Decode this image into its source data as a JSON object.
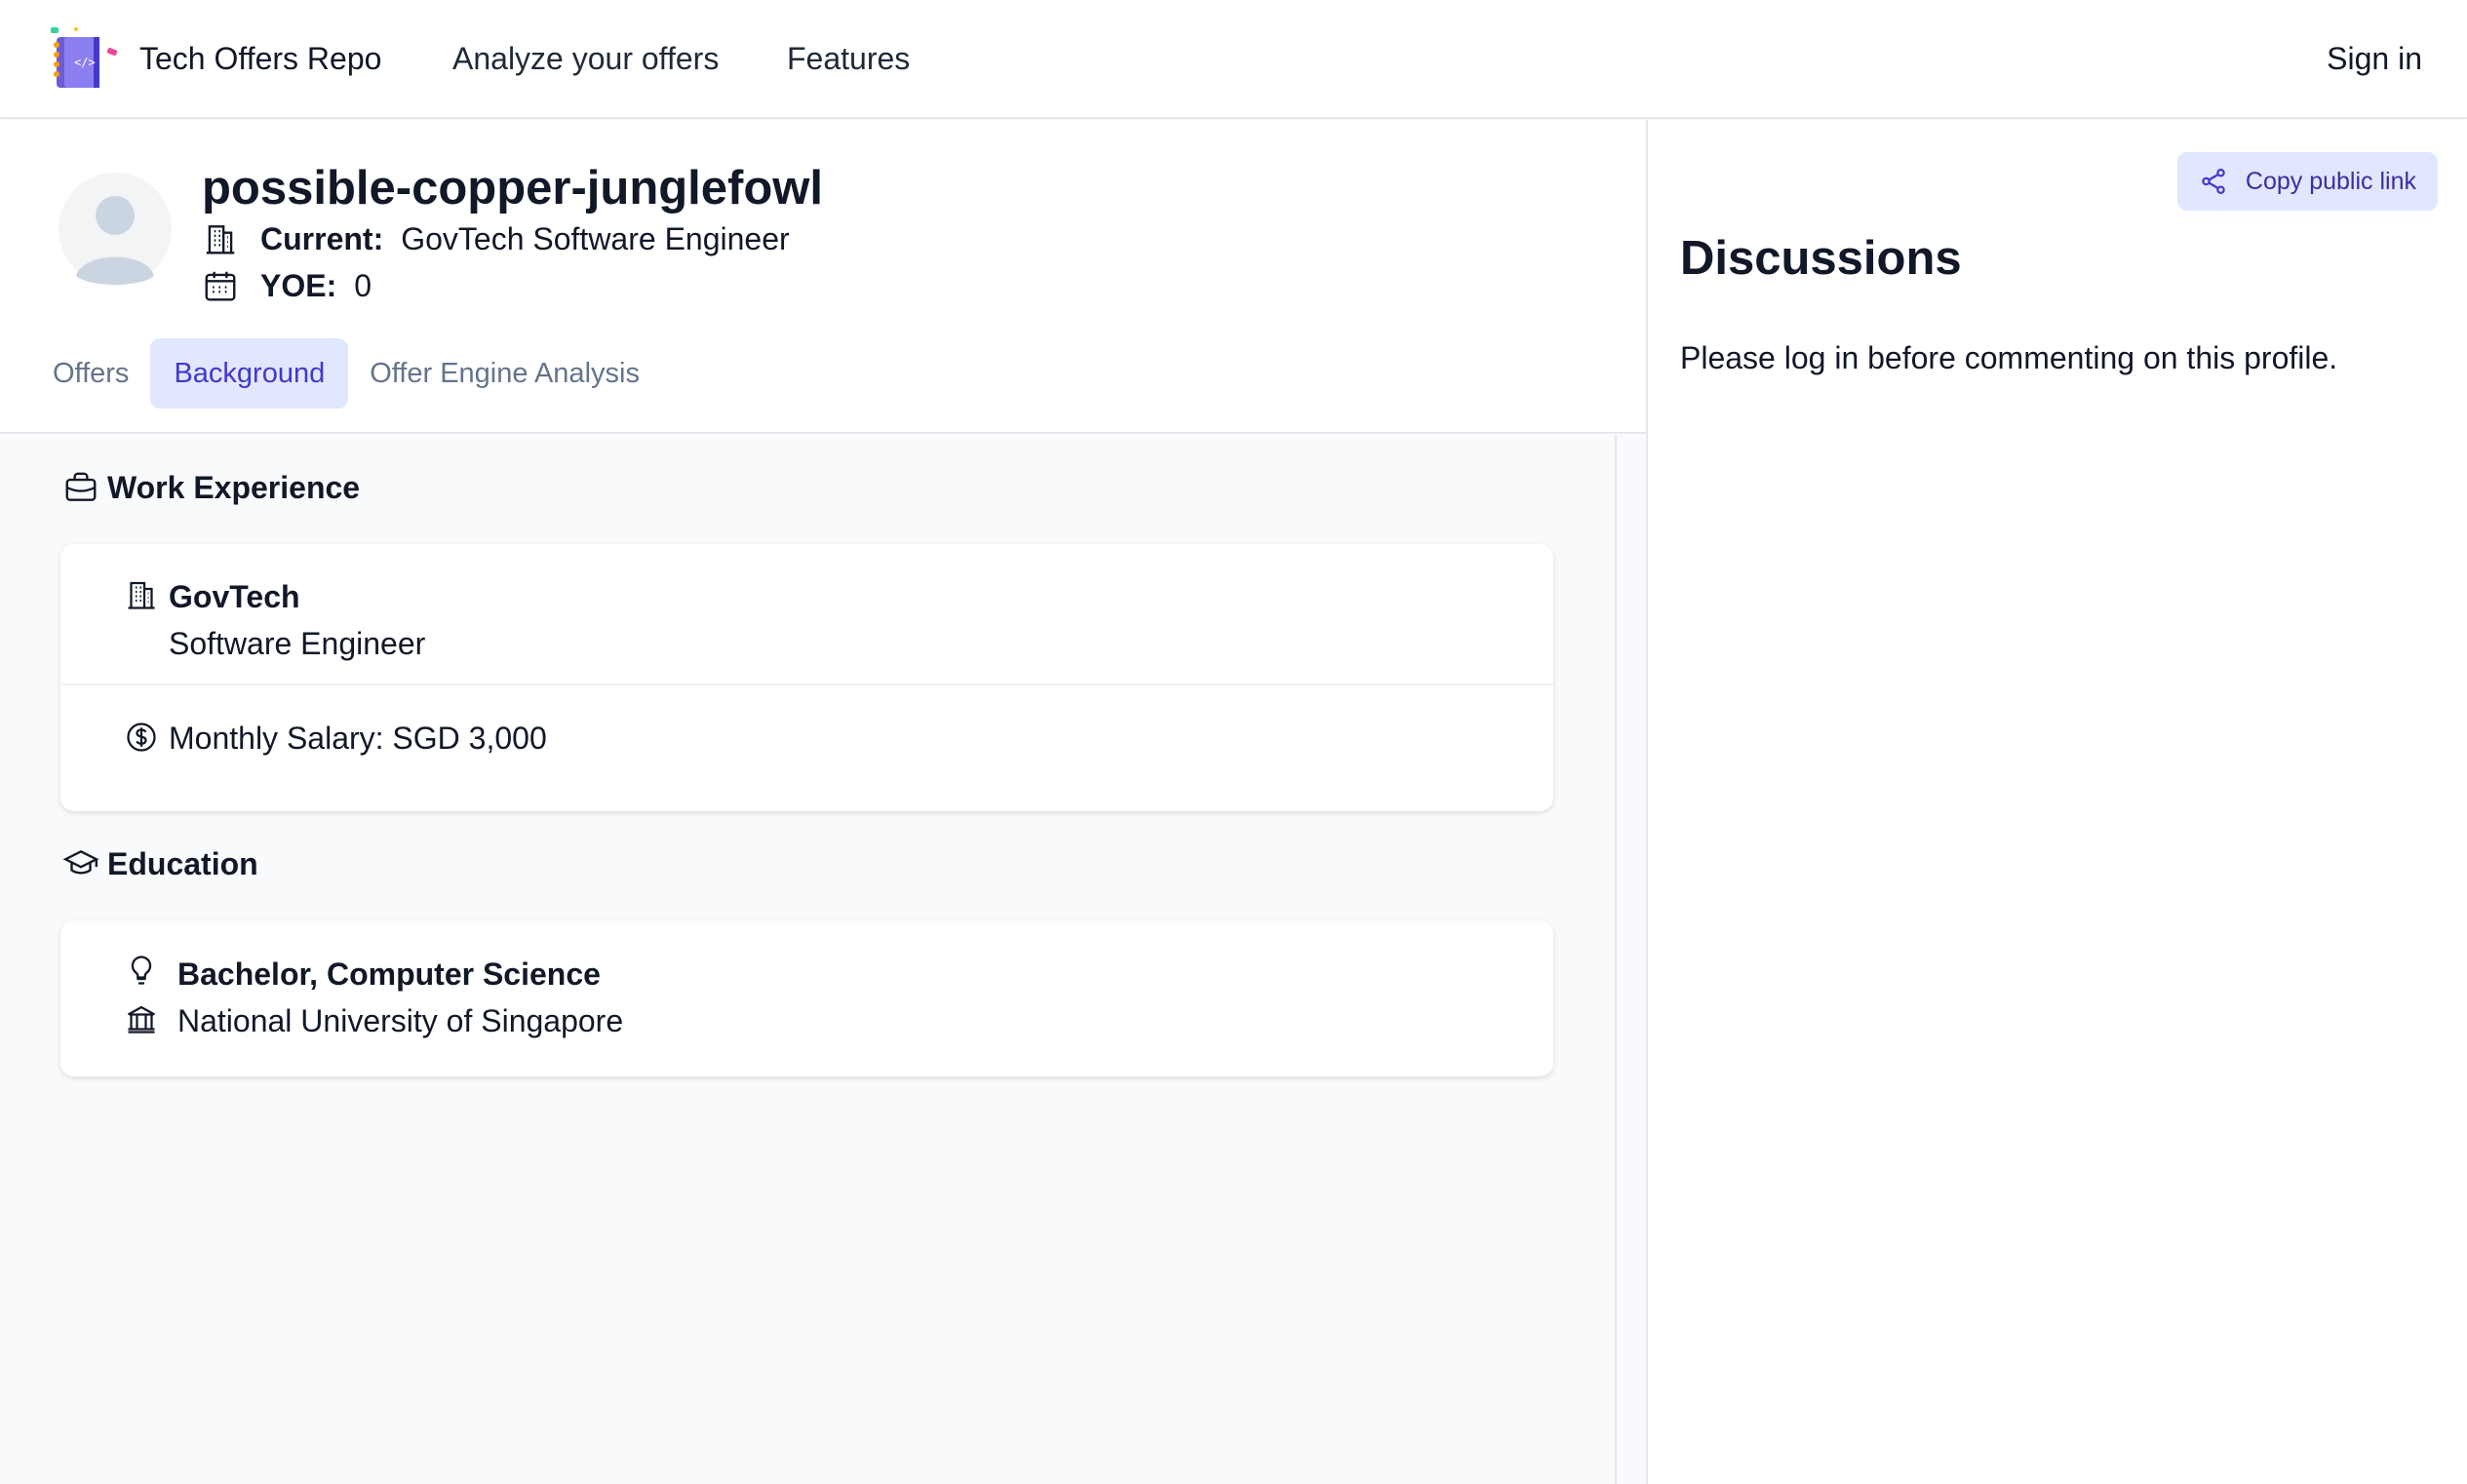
{
  "nav": {
    "brand": "Tech Offers Repo",
    "links": [
      "Analyze your offers",
      "Features"
    ],
    "sign_in": "Sign in"
  },
  "profile": {
    "name": "possible-copper-junglefowl",
    "current_label": "Current:",
    "current_value": "GovTech Software Engineer",
    "yoe_label": "YOE:",
    "yoe_value": "0"
  },
  "tabs": [
    {
      "label": "Offers",
      "active": false
    },
    {
      "label": "Background",
      "active": true
    },
    {
      "label": "Offer Engine Analysis",
      "active": false
    }
  ],
  "background": {
    "work_title": "Work Experience",
    "work": {
      "company": "GovTech",
      "title": "Software Engineer",
      "salary": "Monthly Salary: SGD 3,000"
    },
    "education_title": "Education",
    "education": {
      "degree": "Bachelor, Computer Science",
      "school": "National University of Singapore"
    }
  },
  "discussions": {
    "copy_link": "Copy public link",
    "title": "Discussions",
    "note": "Please log in before commenting on this profile."
  },
  "colors": {
    "accent_bg": "#e0e7ff",
    "accent_text": "#4338ca",
    "content_bg": "#f8fafc"
  }
}
